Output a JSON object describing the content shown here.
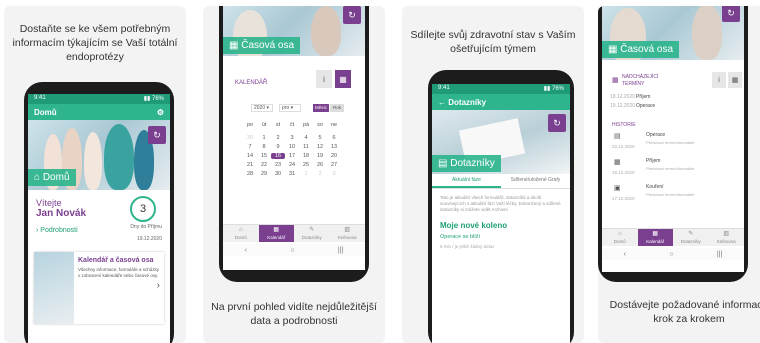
{
  "cards": {
    "c1": {
      "caption": "Dostaňte se ke všem potřebným informacím týkajícím se Vaší totální endoprotézy",
      "appbar_title": "Domů",
      "section_tab": "Domů",
      "welcome": "Vítejte",
      "user_name": "Jan Novák",
      "details_link": "› Podrobnosti",
      "days_count": "3",
      "days_label": "Dny do Příjmu",
      "date": "19.12.2020",
      "promo_title": "Kalendář a časová osa",
      "promo_text": "Všechny informace, formuláře a schůzky v zobrazení kalendáře nebo časové osy."
    },
    "c2": {
      "caption": "Na první pohled vidíte nejdůležitější data a podrobnosti",
      "section_tab": "Časová osa",
      "calendar_label": "KALENDÁŘ",
      "year": "2020",
      "month": "pro",
      "view_month": "Měsíc",
      "view_week": "Rok",
      "weekdays": [
        "po",
        "út",
        "st",
        "čt",
        "pá",
        "so",
        "ne"
      ],
      "days": [
        "30",
        "1",
        "2",
        "3",
        "4",
        "5",
        "6",
        "7",
        "8",
        "9",
        "10",
        "11",
        "12",
        "13",
        "14",
        "15",
        "16",
        "17",
        "18",
        "19",
        "20",
        "21",
        "22",
        "23",
        "24",
        "25",
        "26",
        "27",
        "28",
        "29",
        "30",
        "31",
        "1",
        "2",
        "3"
      ],
      "today": "16",
      "tabs": [
        "Domů",
        "Kalendář",
        "Dotazníky",
        "Knihovna"
      ],
      "nav_icons": [
        "‹",
        "○",
        "|||"
      ]
    },
    "c3": {
      "caption": "Sdílejte svůj zdravotní stav s Vaším ošetřujícím týmem",
      "appbar_title": "Dotazníky",
      "section_tab": "Dotazníky",
      "tab_current": "Aktuální fáze",
      "tab_done": "Sdílené/uložené Grafy",
      "intro": "Tato je aktuální všech formulářů, dotazníků a úkolů souvisejících s aktuální fází Vaší léčby. Dokončený a sdílené dotazníky si můžete vidět Archivní",
      "question_title": "Moje nové koleno",
      "question_sub": "Operace se blíží",
      "question_meta": "5 min / je ještě žádný dotaz"
    },
    "c4": {
      "caption": "Dostávejte požadované informace krok za krokem",
      "section_tab": "Časová osa",
      "upcoming_label": "NADCHÁZEJÍCÍ TERMÍNY",
      "upcoming": [
        {
          "date": "18.12.2020",
          "title": "Příjem"
        },
        {
          "date": "19.12.2020",
          "title": "Operace"
        }
      ],
      "history_label": "HISTORIE",
      "history": [
        {
          "date": "22.12.2020",
          "title": "Operace",
          "sub": "Předchozí termín/formuláře"
        },
        {
          "date": "18.12.2020",
          "title": "Příjem",
          "sub": "Předchozí termín/formuláře"
        },
        {
          "date": "17.12.2020",
          "title": "Kouření",
          "sub": "Předchozí termín/formuláře"
        }
      ],
      "tabs": [
        "Domů",
        "Kalendář",
        "Dotazníky",
        "Knihovna"
      ]
    }
  },
  "colors": {
    "green": "#2fb58e",
    "purple": "#7a3f8f",
    "dark": "#1c1c1c"
  }
}
